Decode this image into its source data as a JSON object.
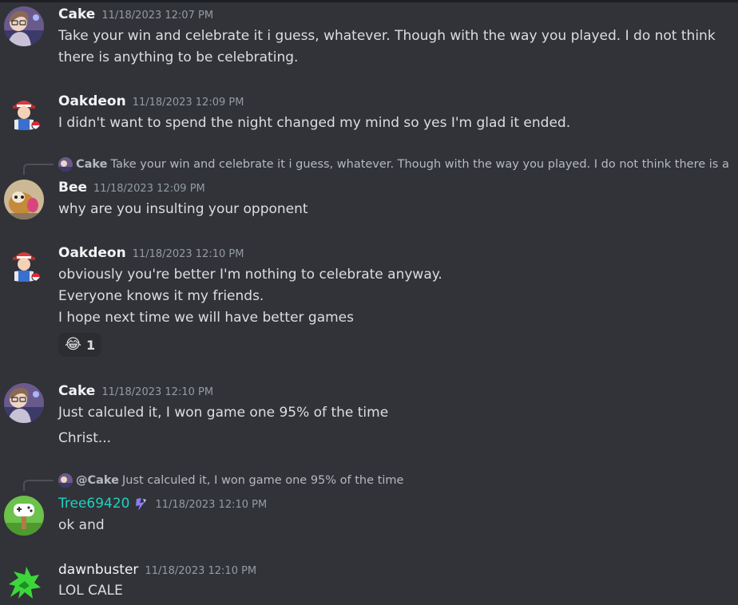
{
  "messages": [
    {
      "username": "Cake",
      "timestamp": "11/18/2023 12:07 PM",
      "lines": [
        "Take your win and celebrate it i guess, whatever. Though with the way you played. I do not think",
        "there is anything to be celebrating."
      ]
    },
    {
      "username": "Oakdeon",
      "timestamp": "11/18/2023 12:09 PM",
      "lines": [
        "I didn't want to spend the night changed my mind so yes I'm glad it ended."
      ]
    },
    {
      "reply": {
        "name": "Cake",
        "text": "Take your win and celebrate it i guess, whatever. Though with the way you played. I do not think there is a"
      },
      "username": "Bee",
      "timestamp": "11/18/2023 12:09 PM",
      "lines": [
        "why are you insulting your opponent"
      ]
    },
    {
      "username": "Oakdeon",
      "timestamp": "11/18/2023 12:10 PM",
      "lines": [
        "obviously you're better I'm nothing to celebrate anyway.",
        "Everyone knows it my friends.",
        "I hope next time we will have better games"
      ],
      "reaction": {
        "emoji": "😂",
        "count": "1"
      }
    },
    {
      "username": "Cake",
      "timestamp": "11/18/2023 12:10 PM",
      "lines": [
        "Just calculed it, I won game one 95% of the time",
        "Christ..."
      ]
    },
    {
      "reply": {
        "name": "@Cake",
        "text": "Just calculed it, I won game one 95% of the time"
      },
      "username": "Tree69420",
      "timestamp": "11/18/2023 12:10 PM",
      "lines": [
        "ok and"
      ],
      "name_color": "#1fd1c2"
    },
    {
      "username": "dawnbuster",
      "timestamp": "11/18/2023 12:10 PM",
      "lines": [
        "LOL CALE"
      ]
    }
  ],
  "icons": {
    "reaction": "laughing-tears-emoji",
    "badge": "purple-lightning-badge"
  },
  "colors": {
    "background": "#313338",
    "text": "#dbdee1",
    "timestamp": "#949ba4",
    "teal_name": "#1fd1c2"
  }
}
